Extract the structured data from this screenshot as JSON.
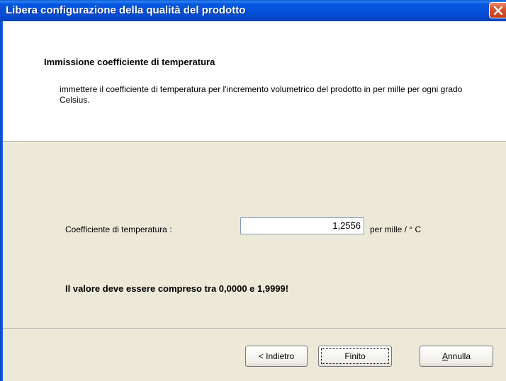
{
  "window": {
    "title": "Libera configurazione della qualità del prodotto"
  },
  "header": {
    "title": "Immissione coefficiente di temperatura",
    "description": "immettere il coefficiente di temperatura per l'incremento volumetrico del prodotto in per mille per ogni grado Celsius."
  },
  "form": {
    "coefficient_label": "Coefficiente di temperatura :",
    "coefficient_value": "1,2556",
    "unit_label": "per mille / ° C"
  },
  "warning": "Il valore deve essere compreso tra 0,0000 e 1,9999!",
  "buttons": {
    "back_label": "< Indietro",
    "finish_label": "Finito",
    "cancel_accel": "A",
    "cancel_rest": "nnulla"
  },
  "icons": {
    "close": "close-icon"
  },
  "colors": {
    "titlebar": "#0450d8",
    "close_button": "#d9502c",
    "dialog_background": "#ece9d8",
    "header_background": "#ffffff"
  }
}
